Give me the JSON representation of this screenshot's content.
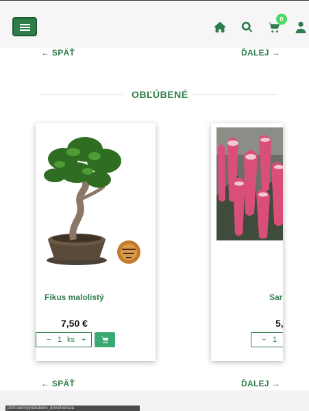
{
  "header": {
    "cart_count": "0"
  },
  "pagination": {
    "back_label": "← SPÄŤ",
    "next_label": "ĎALEJ →"
  },
  "section": {
    "title": "OBĽÚBENÉ"
  },
  "products": [
    {
      "name": "Fikus malolistý",
      "price": "7,50 €",
      "qty_minus": "−",
      "qty_value": "1",
      "qty_unit": "ks",
      "qty_plus": "+"
    },
    {
      "name": "Sar",
      "price": "5,",
      "qty_minus": "−",
      "qty_value": "1"
    }
  ],
  "status_bar": {
    "text": "print-ceninyyoblubene_drevotnerasa"
  },
  "colors": {
    "accent": "#2f7d4a",
    "cart_button": "#3aaa73",
    "badge": "#4cd964"
  },
  "icons": [
    "menu-icon",
    "home-icon",
    "search-icon",
    "cart-icon",
    "user-icon",
    "add-to-cart-icon"
  ]
}
